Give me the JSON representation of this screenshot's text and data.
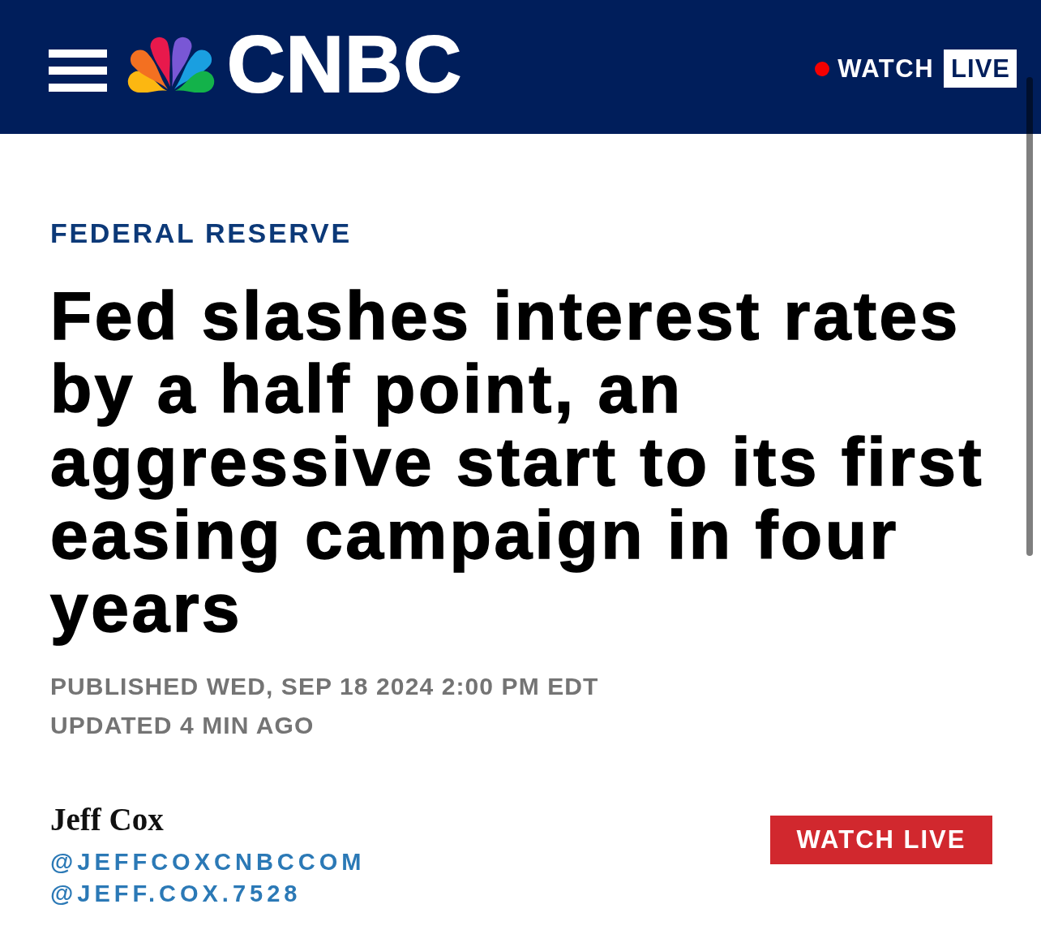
{
  "header": {
    "logo_text": "CNBC",
    "watch": {
      "label": "WATCH",
      "badge": "LIVE"
    }
  },
  "article": {
    "section": "FEDERAL RESERVE",
    "headline": "Fed slashes interest rates by a half point, an aggressive start to its first easing campaign in four years",
    "published": "PUBLISHED WED, SEP 18 2024 2:00 PM EDT",
    "updated": "UPDATED 4 MIN AGO"
  },
  "author": {
    "name": "Jeff Cox",
    "handles": [
      "@JEFFCOXCNBCCOM",
      "@JEFF.COX.7528"
    ]
  },
  "watch_live_button": {
    "label": "WATCH LIVE"
  }
}
